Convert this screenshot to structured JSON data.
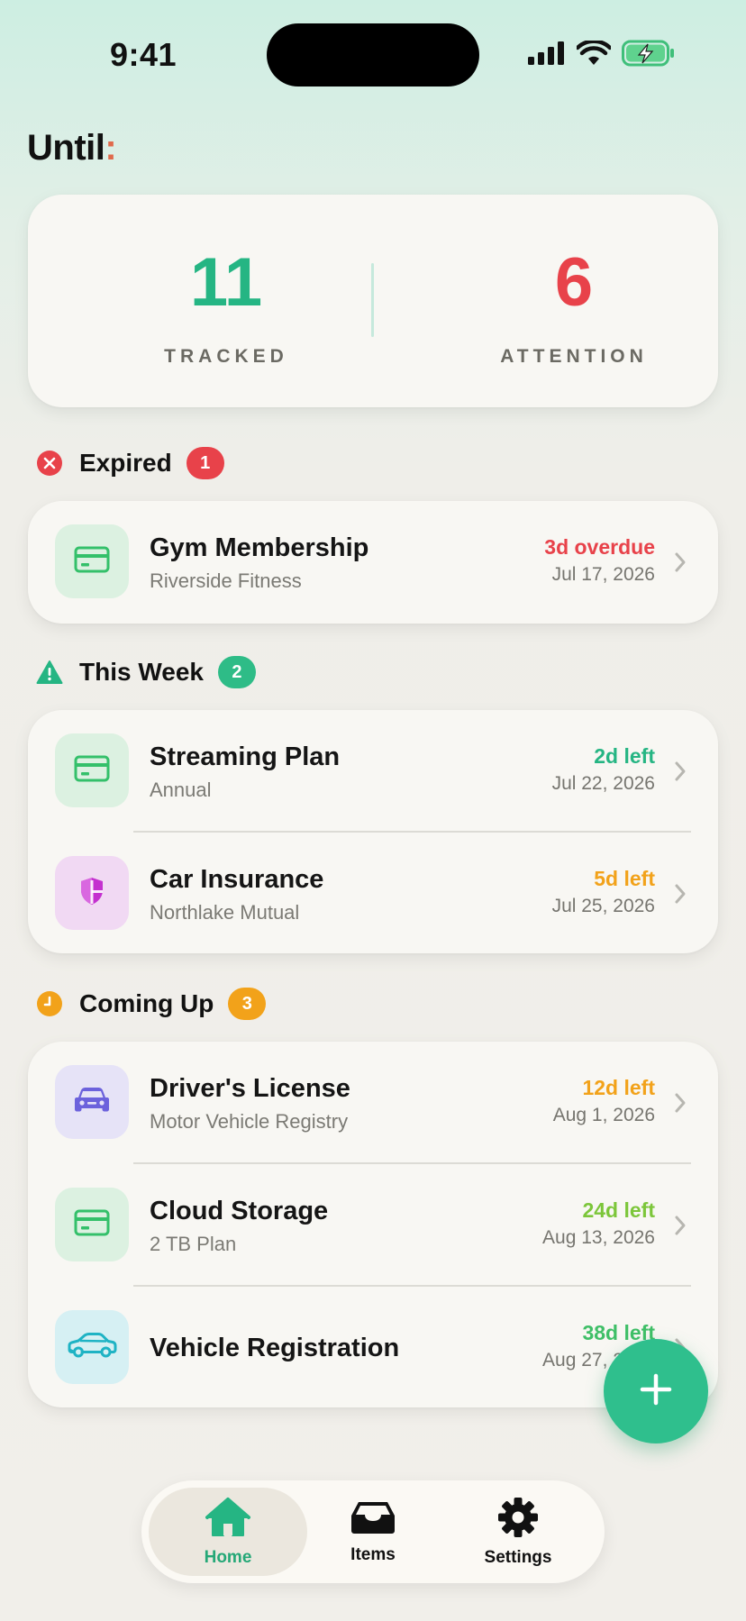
{
  "status_bar": {
    "time": "9:41"
  },
  "app": {
    "title": "Until",
    "title_mark": ":"
  },
  "summary": {
    "tracked_value": "11",
    "tracked_label": "TRACKED",
    "attention_value": "6",
    "attention_label": "ATTENTION"
  },
  "sections": {
    "expired": {
      "title": "Expired",
      "count": "1",
      "items": [
        {
          "title": "Gym Membership",
          "subtitle": "Riverside Fitness",
          "due": "3d overdue",
          "date": "Jul 17, 2026",
          "icon": "card-icon"
        }
      ]
    },
    "this_week": {
      "title": "This Week",
      "count": "2",
      "items": [
        {
          "title": "Streaming Plan",
          "subtitle": "Annual",
          "due": "2d left",
          "date": "Jul 22, 2026",
          "icon": "card-icon"
        },
        {
          "title": "Car Insurance",
          "subtitle": "Northlake Mutual",
          "due": "5d left",
          "date": "Jul 25, 2026",
          "icon": "shield-icon"
        }
      ]
    },
    "coming_up": {
      "title": "Coming Up",
      "count": "3",
      "items": [
        {
          "title": "Driver's License",
          "subtitle": "Motor Vehicle Registry",
          "due": "12d left",
          "date": "Aug 1, 2026",
          "icon": "car-front-icon"
        },
        {
          "title": "Cloud Storage",
          "subtitle": "2 TB Plan",
          "due": "24d left",
          "date": "Aug 13, 2026",
          "icon": "card-icon"
        },
        {
          "title": "Vehicle Registration",
          "subtitle": "",
          "due": "38d left",
          "date": "Aug 27, 2026",
          "icon": "car-side-icon"
        }
      ]
    }
  },
  "tabbar": {
    "home": "Home",
    "items": "Items",
    "settings": "Settings"
  },
  "colors": {
    "accent": "#25b583",
    "danger": "#e8424a",
    "warning": "#f2a21a",
    "lime": "#7cc63a"
  }
}
